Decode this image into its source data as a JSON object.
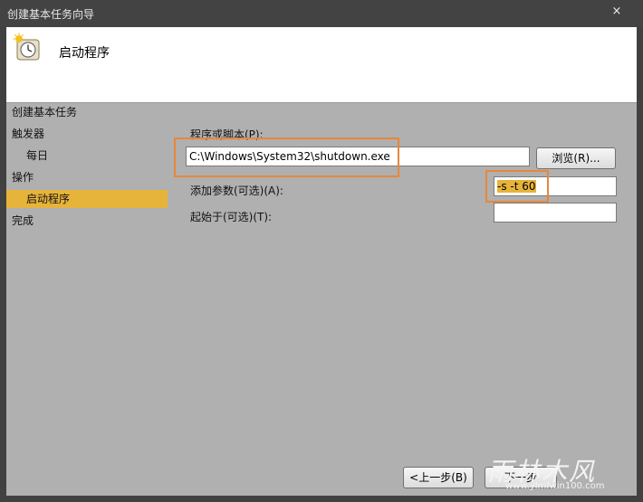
{
  "window": {
    "title": "创建基本任务向导",
    "close_glyph": "×"
  },
  "header": {
    "title": "启动程序",
    "icon": "clock-icon"
  },
  "steps": [
    {
      "label": "创建基本任务",
      "active": false
    },
    {
      "label": "触发器",
      "active": false
    },
    {
      "label": "每日",
      "active": false
    },
    {
      "label": "操作",
      "active": false
    },
    {
      "label": "启动程序",
      "active": true
    },
    {
      "label": "完成",
      "active": false
    }
  ],
  "form": {
    "program_label": "程序或脚本(P):",
    "program_value": "C:\\Windows\\System32\\shutdown.exe",
    "browse_label": "浏览(R)...",
    "args_label": "添加参数(可选)(A):",
    "args_value": "-s -t 60",
    "startin_label": "起始于(可选)(T):",
    "startin_value": ""
  },
  "buttons": {
    "back_label": "<上一步(B)",
    "next_label": "下一步"
  },
  "watermark": {
    "text": "雨林木风",
    "url": "www.ylmfwin100.com"
  },
  "colors": {
    "highlight": "#e7b43b",
    "annotation": "#e8873a"
  }
}
